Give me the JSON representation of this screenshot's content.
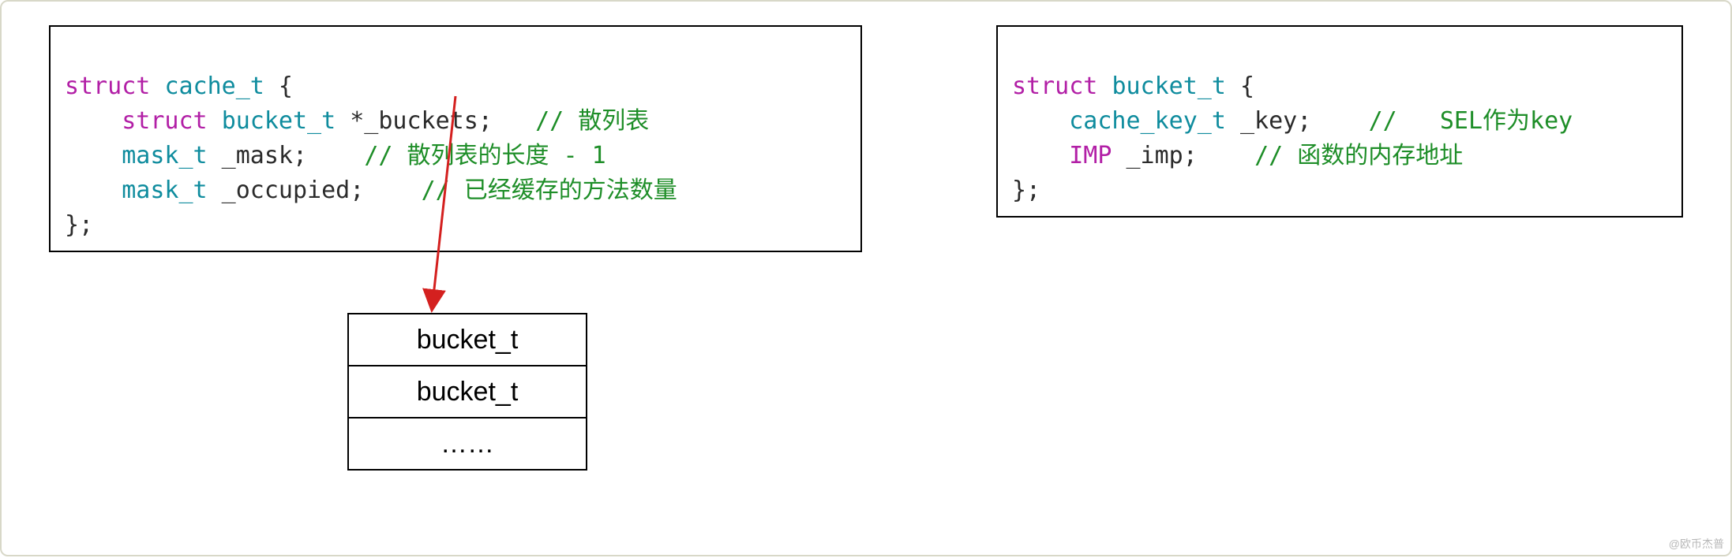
{
  "left_code": {
    "l1_kw": "struct",
    "l1_name": "cache_t",
    "l1_tail": " {",
    "l2_indent": "    ",
    "l2_kw": "struct",
    "l2_type": "bucket_t",
    "l2_rest": " *_buckets;   ",
    "l2_comment": "// 散列表",
    "l3_indent": "    ",
    "l3_type": "mask_t",
    "l3_rest": " _mask;    ",
    "l3_comment": "// 散列表的长度 - 1",
    "l4_indent": "    ",
    "l4_type": "mask_t",
    "l4_rest": " _occupied;    ",
    "l4_comment": "// 已经缓存的方法数量",
    "l5": "};"
  },
  "right_code": {
    "l1_kw": "struct",
    "l1_name": "bucket_t",
    "l1_tail": " {",
    "l2_indent": "    ",
    "l2_type": "cache_key_t",
    "l2_rest": " _key;    ",
    "l2_comment": "//   SEL作为key",
    "l3_indent": "    ",
    "l3_type": "IMP",
    "l3_rest": " _imp;    ",
    "l3_comment": "// 函数的内存地址",
    "l4": "};"
  },
  "table": {
    "row1": "bucket_t",
    "row2": "bucket_t",
    "row3": "……"
  },
  "watermark": "@欧币杰普"
}
